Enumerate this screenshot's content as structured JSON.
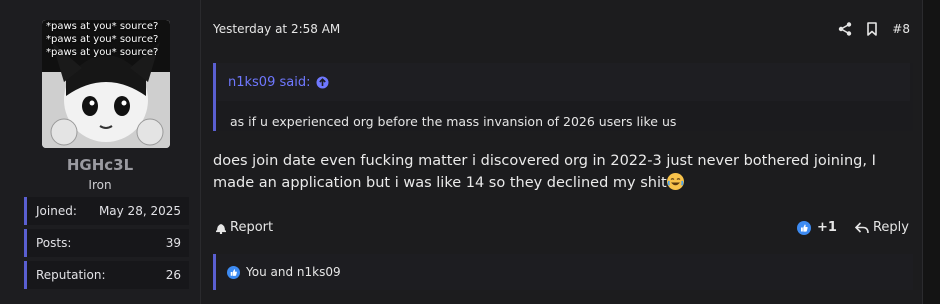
{
  "user": {
    "name": "HGHc3L",
    "title": "Iron",
    "avatar_text": [
      "*paws at you* source?",
      "*paws at you* source?",
      "*paws at you* source?"
    ],
    "stats": [
      {
        "label": "Joined:",
        "value": "May 28, 2025"
      },
      {
        "label": "Posts:",
        "value": "39"
      },
      {
        "label": "Reputation:",
        "value": "26"
      }
    ]
  },
  "post": {
    "date": "Yesterday at 2:58 AM",
    "number": "#8",
    "quote": {
      "author": "n1ks09 said:",
      "text": "as if u experienced org before the mass invansion of 2026 users like us"
    },
    "message": "does join date even fucking matter i discovered org in 2022-3 just never bothered joining, I made an application but i was like 14 so they declined my shit",
    "report_label": "Report",
    "reaction_count": "+1",
    "reply_label": "Reply",
    "reactions_text": "You and n1ks09"
  },
  "colors": {
    "accent": "#5a5fd1",
    "quote_author": "#6f78ff",
    "like_blue": "#3d8bf2"
  },
  "icons": {
    "share": "share-icon",
    "bookmark": "bookmark-icon",
    "arrow_up": "arrow-up-circle-icon",
    "bell": "bell-icon",
    "like": "like-icon",
    "reply": "reply-icon",
    "emoji": "laughing-crying-emoji"
  }
}
